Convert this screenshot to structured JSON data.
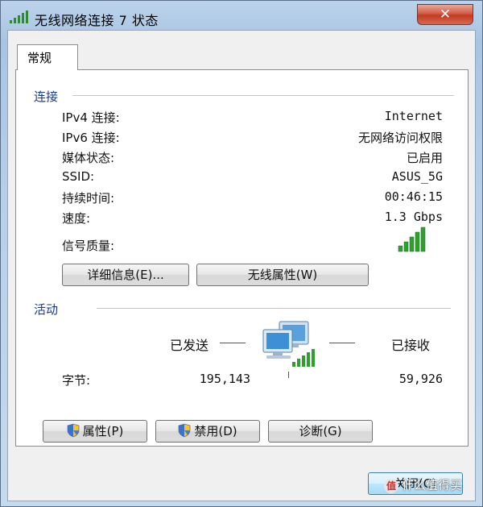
{
  "window": {
    "title": "无线网络连接 7 状态",
    "close_glyph": "✕"
  },
  "tabs": [
    {
      "label": "常规"
    }
  ],
  "connection": {
    "section_label": "连接",
    "rows": [
      {
        "label": "IPv4 连接:",
        "value": "Internet"
      },
      {
        "label": "IPv6 连接:",
        "value": "无网络访问权限"
      },
      {
        "label": "媒体状态:",
        "value": "已启用"
      },
      {
        "label": "SSID:",
        "value": "ASUS_5G"
      },
      {
        "label": "持续时间:",
        "value": "00:46:15"
      },
      {
        "label": "速度:",
        "value": "1.3 Gbps"
      }
    ],
    "signal_label": "信号质量:",
    "signal_bars_lit": 5,
    "signal_bars_total": 5,
    "details_button": "详细信息(E)...",
    "wireless_props_button": "无线属性(W)"
  },
  "activity": {
    "section_label": "活动",
    "sent_label": "已发送",
    "received_label": "已接收",
    "bytes_label": "字节:",
    "bytes_sent": "195,143",
    "bytes_received": "59,926"
  },
  "actions": {
    "properties_button": "属性(P)",
    "disable_button": "禁用(D)",
    "diagnose_button": "诊断(G)"
  },
  "footer": {
    "close_button": "关闭(C)"
  },
  "watermark": {
    "logo_text": "值",
    "text": "什么值得买"
  },
  "colors": {
    "signal_green": "#2fa02f",
    "title_bar": "#b7cfe8",
    "section_label": "#1a3a8a"
  }
}
